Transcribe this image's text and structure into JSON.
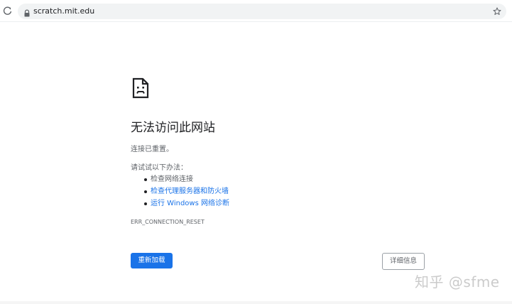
{
  "browser": {
    "url": "scratch.mit.edu",
    "icons": {
      "reload": "reload-icon",
      "lock": "lock-icon",
      "bookmark": "star-icon"
    }
  },
  "error_page": {
    "icon": "sad-page-icon",
    "headline": "无法访问此网站",
    "message": "连接已重置。",
    "try_label": "请试试以下办法：",
    "suggestions": [
      "检查网络连接",
      "检查代理服务器和防火墙",
      "运行 Windows 网络诊断"
    ],
    "error_code": "ERR_CONNECTION_RESET",
    "reload_button": "重新加载",
    "details_button": "详细信息"
  },
  "watermark": "知乎 @sfme",
  "colors": {
    "link": "#1a73e8",
    "primary_button": "#1a73e8",
    "text_primary": "#202124",
    "text_secondary": "#5f6368"
  }
}
